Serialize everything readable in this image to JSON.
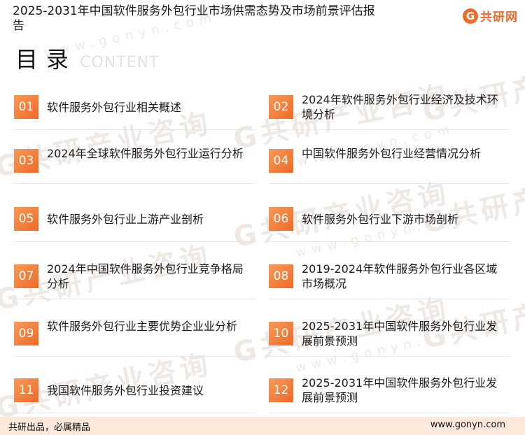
{
  "header": {
    "title": "2025-2031年中国软件服务外包行业市场供需态势及市场前景评估报告",
    "logo_mark": "G",
    "logo_text": "共研网"
  },
  "toc": {
    "title": "目录",
    "subtitle": "CONTENT"
  },
  "items": [
    {
      "num": "01",
      "label": "软件服务外包行业相关概述"
    },
    {
      "num": "02",
      "label": "2024年软件服务外包行业经济及技术环境分析"
    },
    {
      "num": "03",
      "label": "2024年全球软件服务外包行业运行分析"
    },
    {
      "num": "04",
      "label": "中国软件服务外包行业经营情况分析"
    },
    {
      "num": "05",
      "label": "软件服务外包行业上游产业剖析"
    },
    {
      "num": "06",
      "label": "软件服务外包行业下游市场剖析"
    },
    {
      "num": "07",
      "label": "2024年中国软件服务外包行业竞争格局分析"
    },
    {
      "num": "08",
      "label": "2019-2024年软件服务外包行业各区域市场概况"
    },
    {
      "num": "09",
      "label": "软件服务外包行业主要优势企业业分析"
    },
    {
      "num": "10",
      "label": "2025-2031年中国软件服务外包行业发展前景预测"
    },
    {
      "num": "11",
      "label": "我国软件服务外包行业投资建议"
    },
    {
      "num": "12",
      "label": "2025-2031年中国软件服务外包行业发展前景预测"
    }
  ],
  "footer": {
    "slogan": "共研出品，必属精品",
    "url": "www.gonyn.com"
  },
  "watermark": {
    "text": "G共研产业咨询",
    "url": "www.gonyn.com"
  },
  "colors": {
    "accent": "#ee6a26",
    "footer_bg": "#fde9dc"
  }
}
